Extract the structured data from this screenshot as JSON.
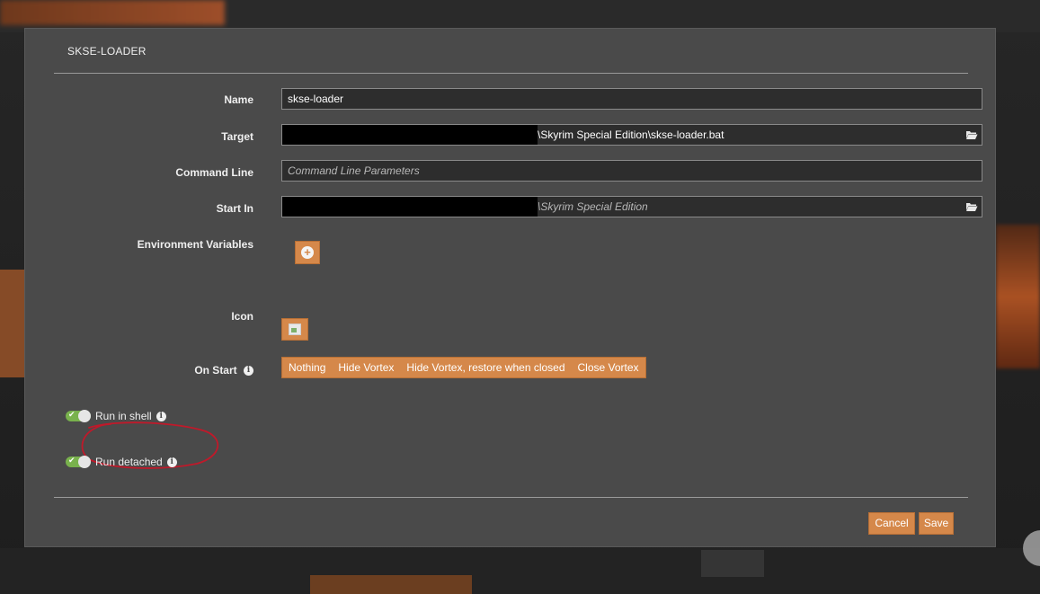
{
  "dialog": {
    "title": "SKSE-LOADER"
  },
  "form": {
    "name": {
      "label": "Name",
      "value": "skse-loader"
    },
    "target": {
      "label": "Target",
      "value": "\\Skyrim Special Edition\\skse-loader.bat",
      "icon": "folder-open-icon"
    },
    "command_line": {
      "label": "Command Line",
      "placeholder": "Command Line Parameters"
    },
    "start_in": {
      "label": "Start In",
      "value": "\\Skyrim Special Edition",
      "icon": "folder-open-icon"
    },
    "env_vars": {
      "label": "Environment Variables",
      "add_icon": "plus-circle-icon"
    },
    "icon": {
      "label": "Icon",
      "image_icon": "broken-image-icon"
    },
    "on_start": {
      "label": "On Start",
      "info_icon": "info-icon",
      "options": [
        "Nothing",
        "Hide Vortex",
        "Hide Vortex, restore when closed",
        "Close Vortex"
      ]
    }
  },
  "toggles": {
    "run_in_shell": {
      "label": "Run in shell",
      "checked": true
    },
    "run_detached": {
      "label": "Run detached",
      "checked": true
    }
  },
  "footer": {
    "cancel_label": "Cancel",
    "save_label": "Save"
  },
  "colors": {
    "accent": "#d5884a",
    "toggle_on": "#79b24d",
    "modal_bg": "#4a4a4a",
    "field_bg": "#2d2d2d",
    "annotation": "#c0192a"
  }
}
